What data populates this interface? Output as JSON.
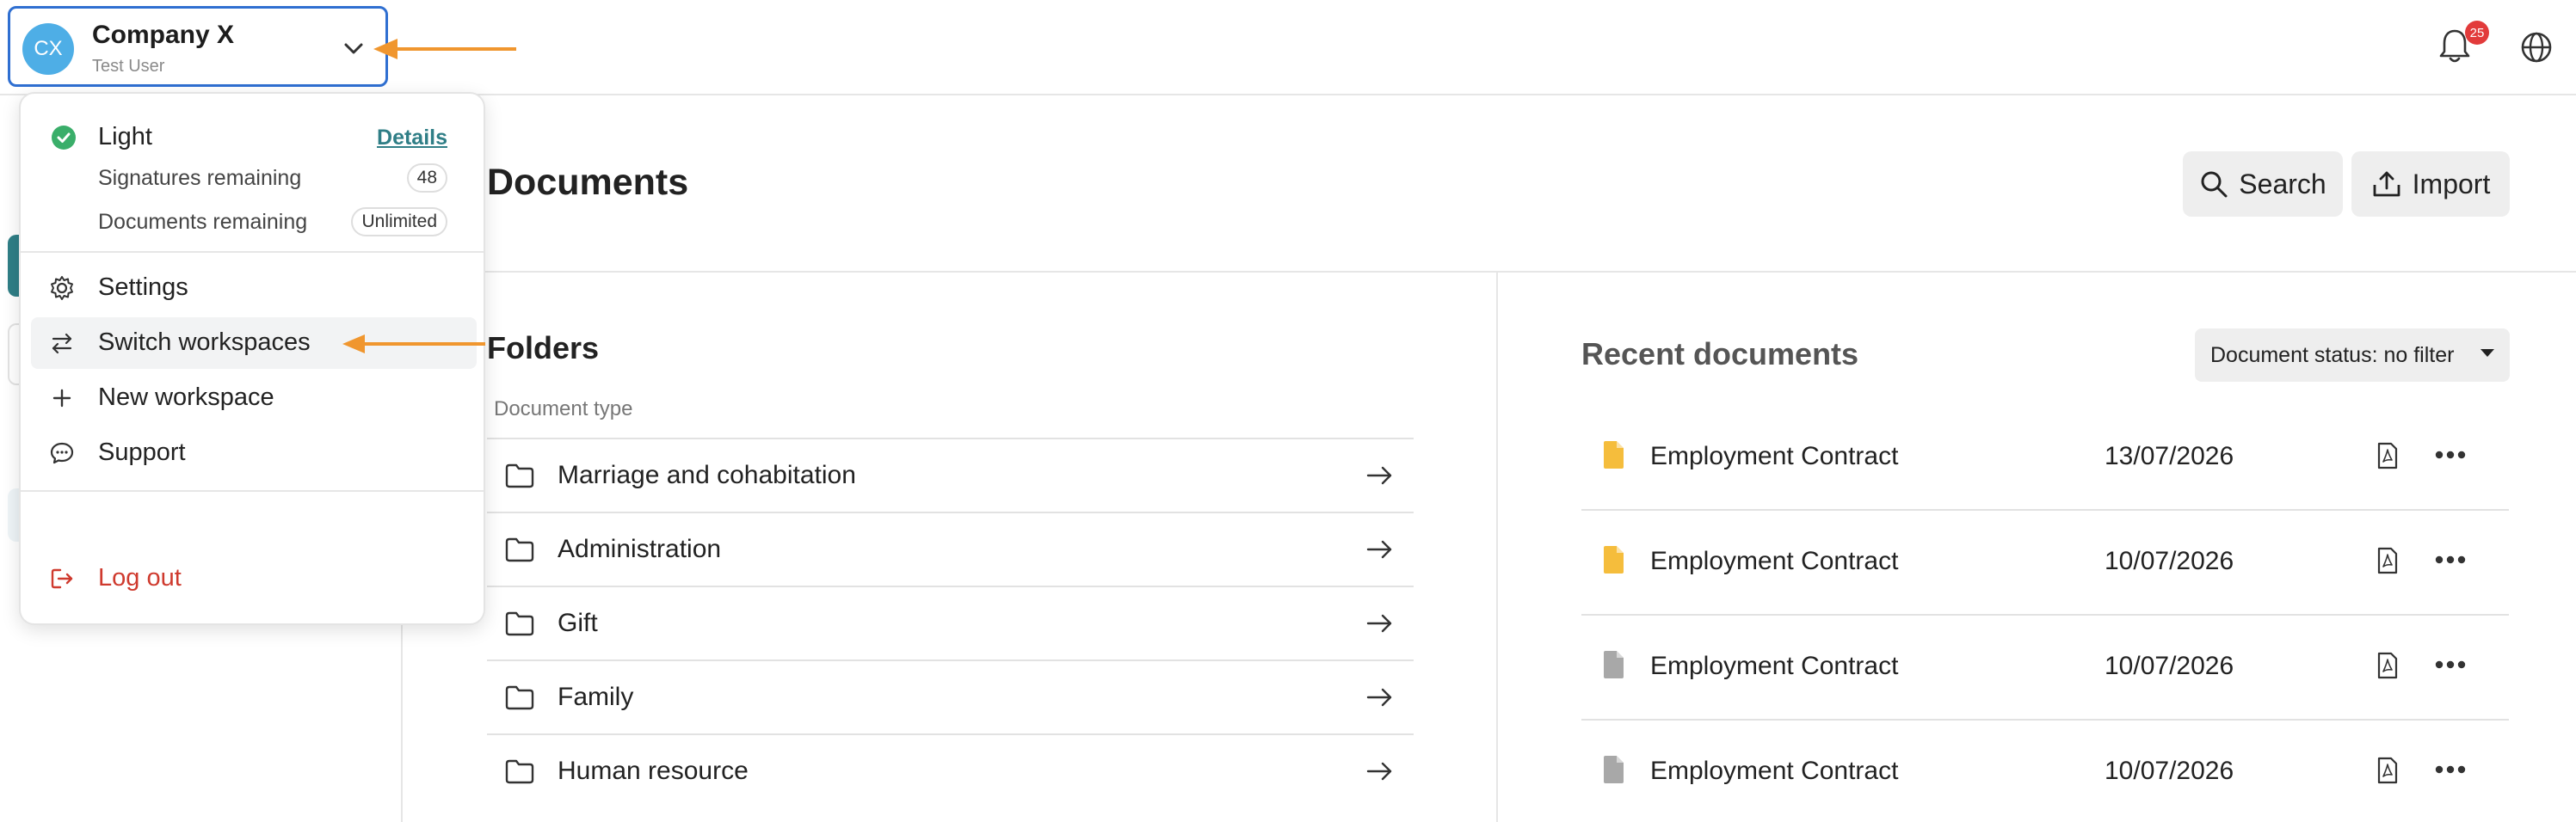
{
  "workspace": {
    "initials": "CX",
    "name": "Company X",
    "user": "Test User"
  },
  "notifications": {
    "count": "25"
  },
  "menu": {
    "plan": {
      "name": "Light",
      "details_link": "Details"
    },
    "quotas": [
      {
        "label": "Signatures remaining",
        "value": "48"
      },
      {
        "label": "Documents remaining",
        "value": "Unlimited"
      }
    ],
    "items": [
      {
        "label": "Settings",
        "icon": "gear-icon"
      },
      {
        "label": "Switch workspaces",
        "icon": "switch-arrows-icon"
      },
      {
        "label": "New workspace",
        "icon": "plus-icon"
      },
      {
        "label": "Support",
        "icon": "chat-bubble-icon"
      }
    ],
    "logout": {
      "label": "Log out",
      "icon": "logout-icon"
    }
  },
  "main": {
    "title": "Documents",
    "search_label": "Search",
    "import_label": "Import"
  },
  "folders": {
    "title": "Folders",
    "subtitle": "Document type",
    "items": [
      "Marriage and cohabitation",
      "Administration",
      "Gift",
      "Family",
      "Human resource"
    ]
  },
  "recent": {
    "title": "Recent documents",
    "filter_label": "Document status: no filter",
    "docs": [
      {
        "name": "Employment Contract",
        "date": "13/07/2026",
        "status_color": "#f5bd3c"
      },
      {
        "name": "Employment Contract",
        "date": "10/07/2026",
        "status_color": "#f5bd3c"
      },
      {
        "name": "Employment Contract",
        "date": "10/07/2026",
        "status_color": "#a8a8a8"
      },
      {
        "name": "Employment Contract",
        "date": "10/07/2026",
        "status_color": "#a8a8a8"
      }
    ]
  },
  "colors": {
    "accent": "#2f7e86",
    "annotation_arrow": "#f0962e",
    "success": "#3aae6a",
    "danger": "#cf3a2e",
    "focus_border": "#2f6fd1"
  }
}
